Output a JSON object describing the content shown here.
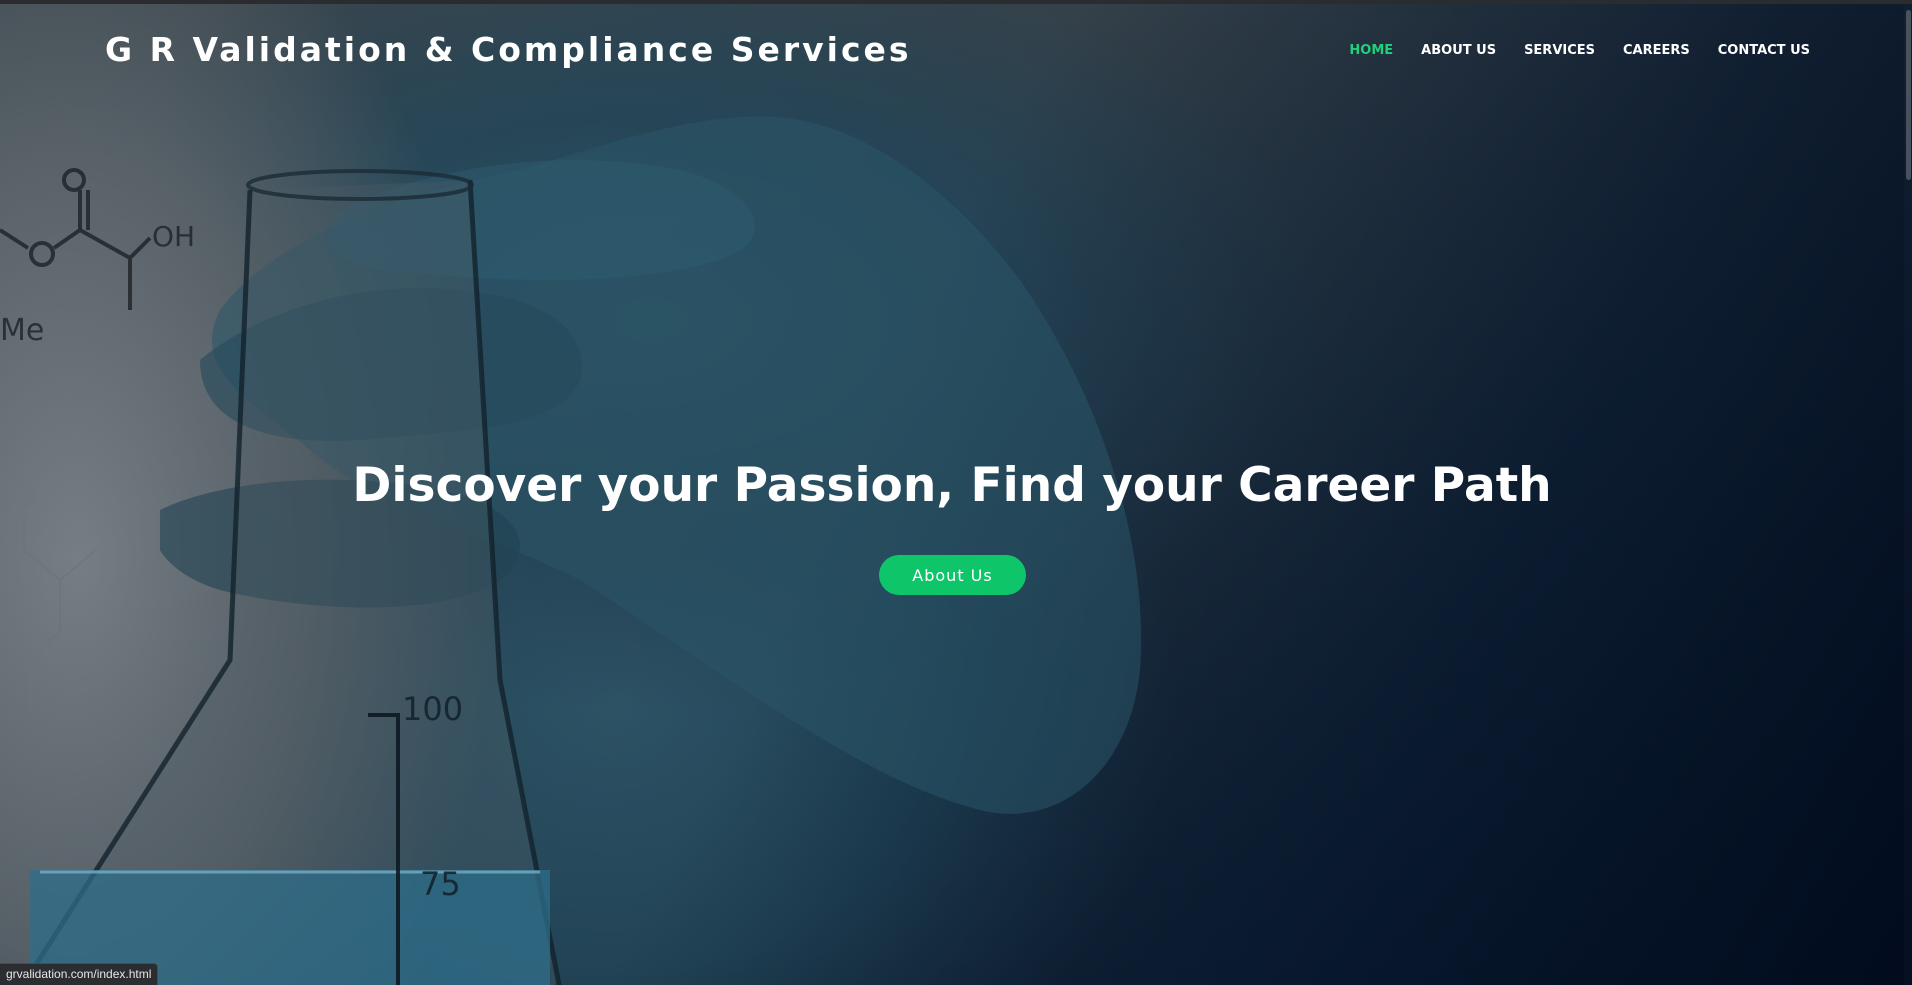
{
  "header": {
    "brand": "G R Validation & Compliance Services",
    "nav": [
      {
        "label": "HOME",
        "active": true
      },
      {
        "label": "ABOUT US",
        "active": false
      },
      {
        "label": "SERVICES",
        "active": false
      },
      {
        "label": "CAREERS",
        "active": false
      },
      {
        "label": "CONTACT US",
        "active": false
      }
    ]
  },
  "hero": {
    "title": "Discover your Passion, Find your Career Path",
    "cta_label": "About Us",
    "background_image": "gloved-hand-holding-lab-flask-photo",
    "molecule_labels": [
      "O",
      "OH",
      "Me"
    ],
    "flask_marks": [
      "100",
      "75"
    ]
  },
  "status_bar": {
    "url": "grvalidation.com/index.html"
  },
  "colors": {
    "accent": "#0fc56a",
    "active_nav": "#1ed17a",
    "overlay_dark": "#031228"
  }
}
